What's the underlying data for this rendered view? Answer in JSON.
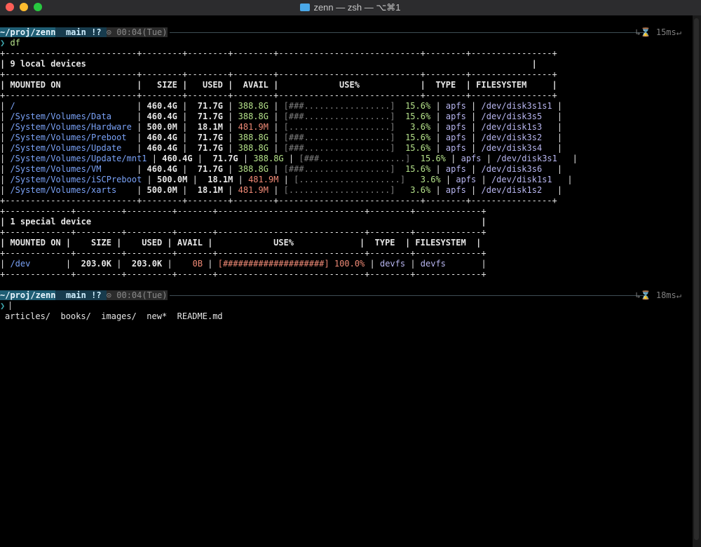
{
  "window": {
    "title": "zenn — zsh — ⌥⌘1"
  },
  "colors": {
    "path_segment": "#1f5e74",
    "git_segment": "#173b4d",
    "avail_ok": "#b5e28a",
    "avail_low": "#f08a76",
    "path_text": "#7aa2f7"
  },
  "prompts": [
    {
      "path": "~/proj/zenn",
      "git_icon": "",
      "branch": "main",
      "git_status": "!?",
      "clock_icon": "⊙",
      "time": "00:04(Tue)",
      "corner_icon": "↳⌛",
      "duration": "15ms",
      "newline_mark": "↵",
      "command": "df"
    },
    {
      "path": "~/proj/zenn",
      "git_icon": "",
      "branch": "main",
      "git_status": "!?",
      "clock_icon": "⊙",
      "time": "00:04(Tue)",
      "corner_icon": "↳⌛",
      "duration": "18ms",
      "newline_mark": "↵",
      "command": ""
    }
  ],
  "prompt_symbol": "❯",
  "local": {
    "border": "+--------------------------+--------+--------+--------+----------------------------+--------+----------------+",
    "title_line": "| 9 local devices                                                                                        |",
    "header": "| MOUNTED ON               |   SIZE |   USED |  AVAIL |            USE%            |  TYPE  | FILESYSTEM     |",
    "rows": [
      {
        "mount": "/",
        "size": "460.4G",
        "used": "71.7G",
        "avail": "388.8G",
        "low": false,
        "bar": "[###.................]",
        "pct": "15.6%",
        "type": "apfs",
        "fs": "/dev/disk3s1s1"
      },
      {
        "mount": "/System/Volumes/Data",
        "size": "460.4G",
        "used": "71.7G",
        "avail": "388.8G",
        "low": false,
        "bar": "[###.................]",
        "pct": "15.6%",
        "type": "apfs",
        "fs": "/dev/disk3s5"
      },
      {
        "mount": "/System/Volumes/Hardware",
        "size": "500.0M",
        "used": "18.1M",
        "avail": "481.9M",
        "low": true,
        "bar": "[....................]",
        "pct": "3.6%",
        "type": "apfs",
        "fs": "/dev/disk1s3"
      },
      {
        "mount": "/System/Volumes/Preboot",
        "size": "460.4G",
        "used": "71.7G",
        "avail": "388.8G",
        "low": false,
        "bar": "[###.................]",
        "pct": "15.6%",
        "type": "apfs",
        "fs": "/dev/disk3s2"
      },
      {
        "mount": "/System/Volumes/Update",
        "size": "460.4G",
        "used": "71.7G",
        "avail": "388.8G",
        "low": false,
        "bar": "[###.................]",
        "pct": "15.6%",
        "type": "apfs",
        "fs": "/dev/disk3s4"
      },
      {
        "mount": "/System/Volumes/Update/mnt1",
        "size": "460.4G",
        "used": "71.7G",
        "avail": "388.8G",
        "low": false,
        "bar": "[###.................]",
        "pct": "15.6%",
        "type": "apfs",
        "fs": "/dev/disk3s1"
      },
      {
        "mount": "/System/Volumes/VM",
        "size": "460.4G",
        "used": "71.7G",
        "avail": "388.8G",
        "low": false,
        "bar": "[###.................]",
        "pct": "15.6%",
        "type": "apfs",
        "fs": "/dev/disk3s6"
      },
      {
        "mount": "/System/Volumes/iSCPreboot",
        "size": "500.0M",
        "used": "18.1M",
        "avail": "481.9M",
        "low": true,
        "bar": "[....................]",
        "pct": "3.6%",
        "type": "apfs",
        "fs": "/dev/disk1s1"
      },
      {
        "mount": "/System/Volumes/xarts",
        "size": "500.0M",
        "used": "18.1M",
        "avail": "481.9M",
        "low": true,
        "bar": "[....................]",
        "pct": "3.6%",
        "type": "apfs",
        "fs": "/dev/disk1s2"
      }
    ]
  },
  "special": {
    "border": "+-------------+---------+---------+-------+-----------------------------+--------+-------------+",
    "title_line": "| 1 special device                                                                             |",
    "header": "| MOUNTED ON |    SIZE |    USED | AVAIL |            USE%             |  TYPE  | FILESYSTEM  |",
    "rows": [
      {
        "mount": "/dev",
        "size": "203.0K",
        "used": "203.0K",
        "avail": "0B",
        "low": true,
        "bar": "[####################]",
        "pct": "100.0%",
        "type": "devfs",
        "fs": "devfs"
      }
    ]
  },
  "listing": "articles/  books/  images/  new*  README.md"
}
